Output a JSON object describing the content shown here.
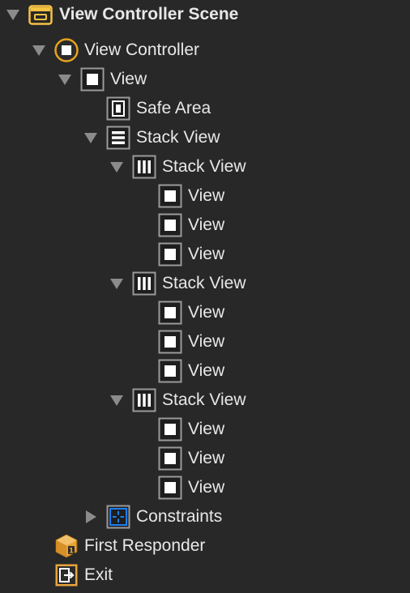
{
  "colors": {
    "background": "#282828",
    "text": "#e8e8e8",
    "icon_stroke": "#9a9a9a",
    "disclosure": "#8b8b8b",
    "vc_ring": "#e6a21e",
    "constraints_blue": "#1a7ff5",
    "orange": "#e8a43a",
    "scene_yellow": "#f5c242"
  },
  "outline": {
    "items": [
      {
        "label": "View Controller Scene",
        "icon": "scene-icon",
        "disclosure": "expanded"
      },
      {
        "label": "View Controller",
        "icon": "view-controller-icon",
        "disclosure": "expanded"
      },
      {
        "label": "View",
        "icon": "view-icon",
        "disclosure": "expanded"
      },
      {
        "label": "Safe Area",
        "icon": "safe-area-icon",
        "disclosure": "none"
      },
      {
        "label": "Stack View",
        "icon": "vertical-stack-icon",
        "disclosure": "expanded"
      },
      {
        "label": "Stack View",
        "icon": "horizontal-stack-icon",
        "disclosure": "expanded"
      },
      {
        "label": "View",
        "icon": "view-icon",
        "disclosure": "none"
      },
      {
        "label": "View",
        "icon": "view-icon",
        "disclosure": "none"
      },
      {
        "label": "View",
        "icon": "view-icon",
        "disclosure": "none"
      },
      {
        "label": "Stack View",
        "icon": "horizontal-stack-icon",
        "disclosure": "expanded"
      },
      {
        "label": "View",
        "icon": "view-icon",
        "disclosure": "none"
      },
      {
        "label": "View",
        "icon": "view-icon",
        "disclosure": "none"
      },
      {
        "label": "View",
        "icon": "view-icon",
        "disclosure": "none"
      },
      {
        "label": "Stack View",
        "icon": "horizontal-stack-icon",
        "disclosure": "expanded"
      },
      {
        "label": "View",
        "icon": "view-icon",
        "disclosure": "none"
      },
      {
        "label": "View",
        "icon": "view-icon",
        "disclosure": "none"
      },
      {
        "label": "View",
        "icon": "view-icon",
        "disclosure": "none"
      },
      {
        "label": "Constraints",
        "icon": "constraints-icon",
        "disclosure": "collapsed"
      },
      {
        "label": "First Responder",
        "icon": "first-responder-icon",
        "disclosure": "none"
      },
      {
        "label": "Exit",
        "icon": "exit-icon",
        "disclosure": "none"
      }
    ]
  }
}
